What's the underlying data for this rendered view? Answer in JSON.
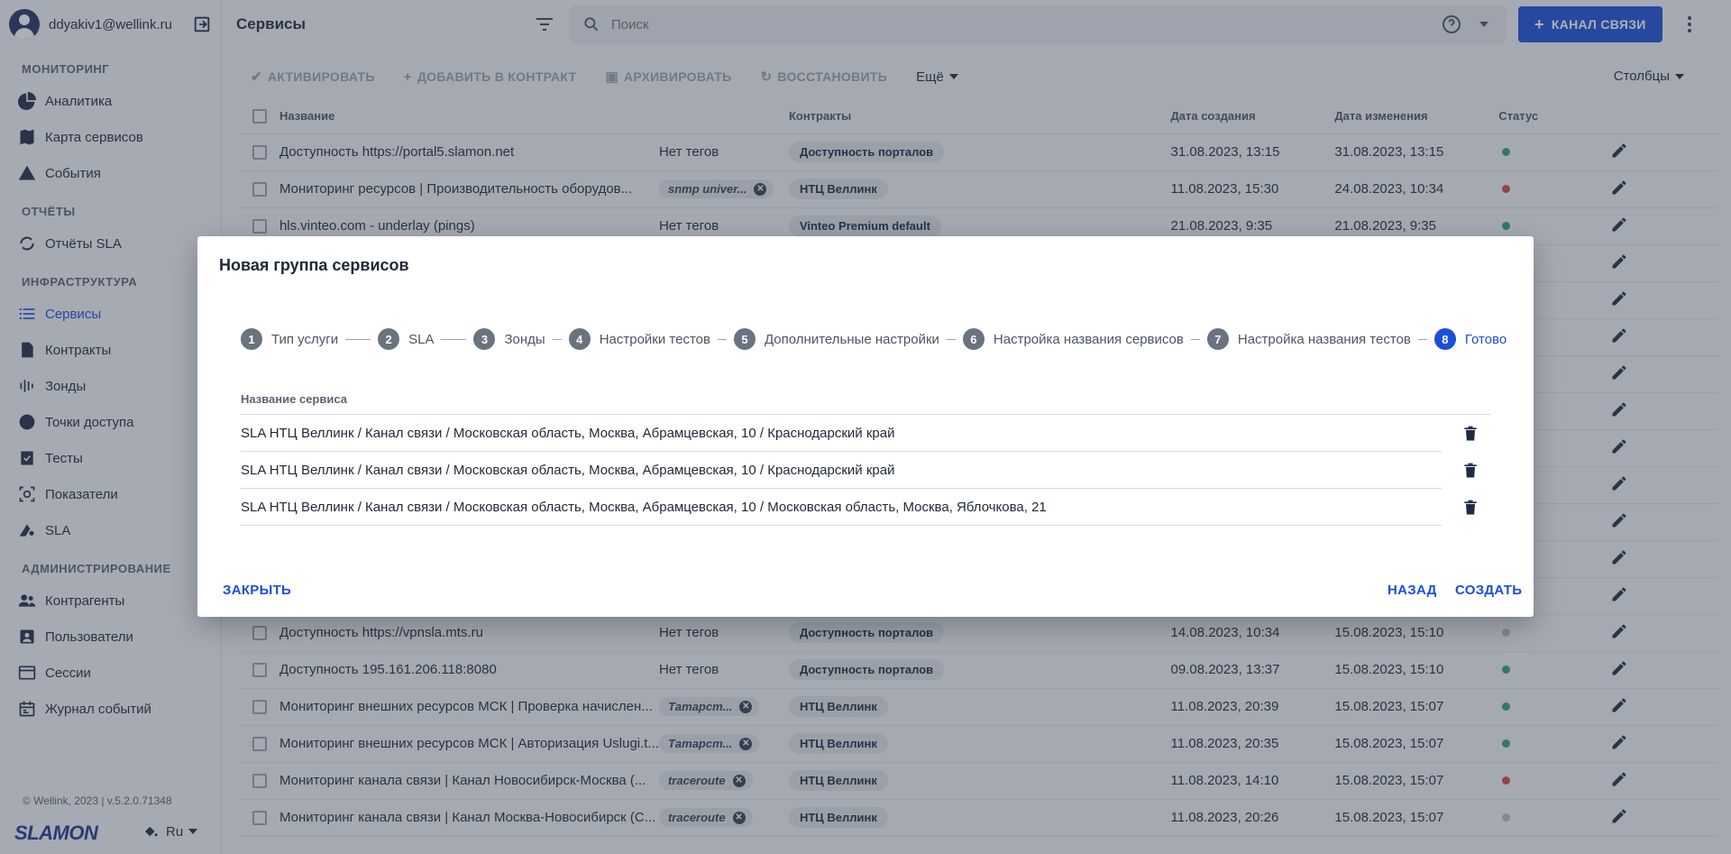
{
  "user": {
    "email": "ddyakiv1@wellink.ru"
  },
  "sidebar": {
    "sections": [
      {
        "title": "МОНИТОРИНГ",
        "items": [
          {
            "label": "Аналитика",
            "icon": "pie-chart-icon"
          },
          {
            "label": "Карта сервисов",
            "icon": "map-icon"
          },
          {
            "label": "События",
            "icon": "warning-icon"
          }
        ]
      },
      {
        "title": "ОТЧЁТЫ",
        "items": [
          {
            "label": "Отчёты SLA",
            "icon": "sync-icon"
          }
        ]
      },
      {
        "title": "ИНФРАСТРУКТУРА",
        "items": [
          {
            "label": "Сервисы",
            "icon": "list-icon",
            "active": true
          },
          {
            "label": "Контракты",
            "icon": "document-icon"
          },
          {
            "label": "Зонды",
            "icon": "probe-icon"
          },
          {
            "label": "Точки доступа",
            "icon": "circle-icon"
          },
          {
            "label": "Тесты",
            "icon": "checklist-icon"
          },
          {
            "label": "Показатели",
            "icon": "metrics-icon"
          },
          {
            "label": "SLA",
            "icon": "speedometer-icon"
          }
        ]
      },
      {
        "title": "АДМИНИСТРИРОВАНИЕ",
        "items": [
          {
            "label": "Контрагенты",
            "icon": "people-icon"
          },
          {
            "label": "Пользователи",
            "icon": "user-card-icon"
          },
          {
            "label": "Сессии",
            "icon": "window-icon"
          },
          {
            "label": "Журнал событий",
            "icon": "calendar-icon"
          }
        ]
      }
    ],
    "copyright": "© Wellink, 2023 | v.5.2.0.71348",
    "logo": "SLAMON",
    "lang": "Ru"
  },
  "topbar": {
    "title": "Сервисы",
    "search_placeholder": "Поиск",
    "primary_button": "КАНАЛ СВЯЗИ"
  },
  "toolbar": {
    "activate": "АКТИВИРОВАТЬ",
    "add_to_contract": "ДОБАВИТЬ В КОНТРАКТ",
    "archive": "АРХИВИРОВАТЬ",
    "restore": "ВОССТАНОВИТЬ",
    "more": "Ещё",
    "columns": "Столбцы"
  },
  "table": {
    "headers": {
      "name": "Название",
      "contracts": "Контракты",
      "created": "Дата создания",
      "modified": "Дата изменения",
      "status": "Статус"
    },
    "rows": [
      {
        "name": "Доступность https://portal5.slamon.net",
        "tag": "Нет тегов",
        "contract": "Доступность порталов",
        "created": "31.08.2023, 13:15",
        "modified": "31.08.2023, 13:15",
        "status": "#2fa36b"
      },
      {
        "name": "Мониторинг ресурсов | Производительность оборудов...",
        "tag": "snmp univer...",
        "contract": "НТЦ Веллинк",
        "created": "11.08.2023, 15:30",
        "modified": "24.08.2023, 10:34",
        "status": "#d64545"
      },
      {
        "name": "hls.vinteo.com - underlay (pings)",
        "tag": "Нет тегов",
        "contract": "Vinteo Premium default",
        "created": "21.08.2023, 9:35",
        "modified": "21.08.2023, 9:35",
        "status": "#2fa36b"
      },
      {
        "name": "",
        "tag": "",
        "contract": "",
        "created": "",
        "modified": "",
        "status": ""
      },
      {
        "name": "",
        "tag": "",
        "contract": "",
        "created": "",
        "modified": "",
        "status": ""
      },
      {
        "name": "",
        "tag": "",
        "contract": "",
        "created": "",
        "modified": "",
        "status": ""
      },
      {
        "name": "",
        "tag": "",
        "contract": "",
        "created": "",
        "modified": "",
        "status": ""
      },
      {
        "name": "",
        "tag": "",
        "contract": "",
        "created": "",
        "modified": "",
        "status": ""
      },
      {
        "name": "",
        "tag": "",
        "contract": "",
        "created": "",
        "modified": "",
        "status": ""
      },
      {
        "name": "",
        "tag": "",
        "contract": "",
        "created": "",
        "modified": "",
        "status": ""
      },
      {
        "name": "",
        "tag": "",
        "contract": "",
        "created": "",
        "modified": "",
        "status": ""
      },
      {
        "name": "",
        "tag": "",
        "contract": "",
        "created": "",
        "modified": "",
        "status": ""
      },
      {
        "name": "",
        "tag": "",
        "contract": "",
        "created": "",
        "modified": "",
        "status": ""
      },
      {
        "name": "Доступность https://vpnsla.mts.ru",
        "tag": "Нет тегов",
        "contract": "Доступность порталов",
        "created": "14.08.2023, 10:34",
        "modified": "15.08.2023, 15:10",
        "status": "#b8bec7"
      },
      {
        "name": "Доступность 195.161.206.118:8080",
        "tag": "Нет тегов",
        "contract": "Доступность порталов",
        "created": "09.08.2023, 13:37",
        "modified": "15.08.2023, 15:10",
        "status": "#2fa36b"
      },
      {
        "name": "Мониторинг внешних ресурсов МСК | Проверка начислен...",
        "tag": "Татарст...",
        "contract": "НТЦ Веллинк",
        "created": "11.08.2023, 20:39",
        "modified": "15.08.2023, 15:07",
        "status": "#2fa36b"
      },
      {
        "name": "Мониторинг внешних ресурсов МСК | Авторизация Uslugi.t...",
        "tag": "Татарст...",
        "contract": "НТЦ Веллинк",
        "created": "11.08.2023, 20:35",
        "modified": "15.08.2023, 15:07",
        "status": "#2fa36b"
      },
      {
        "name": "Мониторинг канала связи | Канал Новосибирск-Москва (...",
        "tag": "traceroute",
        "contract": "НТЦ Веллинк",
        "created": "11.08.2023, 14:10",
        "modified": "15.08.2023, 15:07",
        "status": "#d64545"
      },
      {
        "name": "Мониторинг канала связи | Канал Москва-Новосибирск (С...",
        "tag": "traceroute",
        "contract": "НТЦ Веллинк",
        "created": "11.08.2023, 20:26",
        "modified": "15.08.2023, 15:07",
        "status": "#b8bec7"
      }
    ]
  },
  "modal": {
    "title": "Новая группа сервисов",
    "steps": [
      {
        "num": "1",
        "label": "Тип услуги"
      },
      {
        "num": "2",
        "label": "SLA"
      },
      {
        "num": "3",
        "label": "Зонды"
      },
      {
        "num": "4",
        "label": "Настройки тестов"
      },
      {
        "num": "5",
        "label": "Дополнительные настройки"
      },
      {
        "num": "6",
        "label": "Настройка названия сервисов"
      },
      {
        "num": "7",
        "label": "Настройка названия тестов"
      },
      {
        "num": "8",
        "label": "Готово",
        "active": true
      }
    ],
    "column_header": "Название сервиса",
    "services": [
      "SLA НТЦ Веллинк / Канал связи / Московская область, Москва, Абрамцевская, 10 / Краснодарский край",
      "SLA НТЦ Веллинк / Канал связи / Московская область, Москва, Абрамцевская, 10 / Краснодарский край",
      "SLA НТЦ Веллинк / Канал связи / Московская область, Москва, Абрамцевская, 10 / Московская область, Москва, Яблочкова, 21"
    ],
    "close": "ЗАКРЫТЬ",
    "back": "НАЗАД",
    "create": "СОЗДАТЬ"
  }
}
